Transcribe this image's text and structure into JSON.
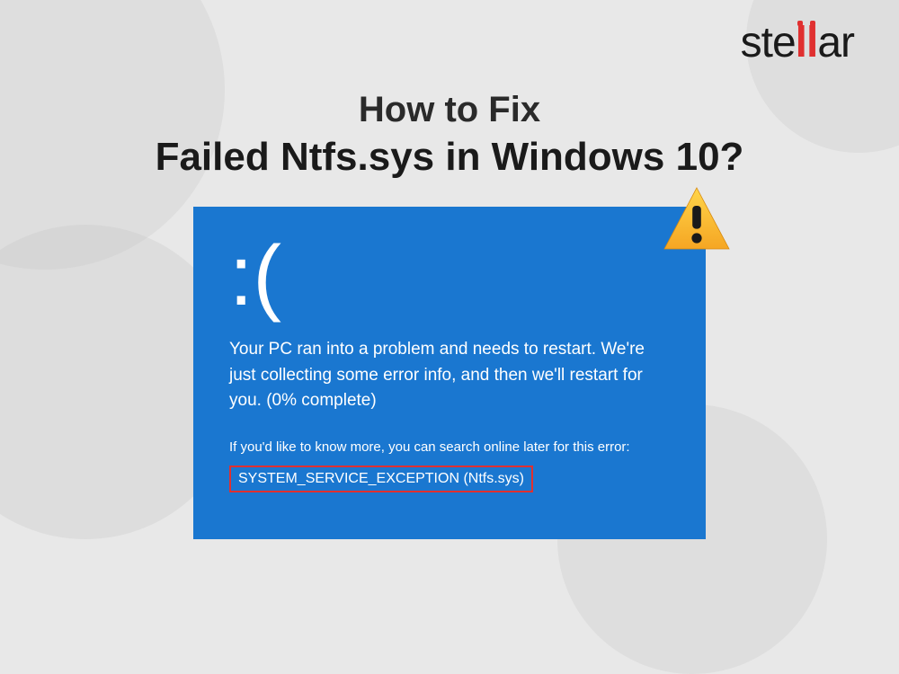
{
  "logo": {
    "text_pre": "ste",
    "text_accent": "ll",
    "text_post": "ar"
  },
  "title": {
    "line1": "How to Fix",
    "line2": "Failed Ntfs.sys in Windows 10?"
  },
  "bsod": {
    "sad_face": ":(",
    "message1": "Your PC ran into a problem and needs to restart. We're just collecting some error info, and then we'll restart for you. (0% complete)",
    "message2": "If you'd like to know more, you can search online later for this error:",
    "error_code": "SYSTEM_SERVICE_EXCEPTION (Ntfs.sys)"
  }
}
